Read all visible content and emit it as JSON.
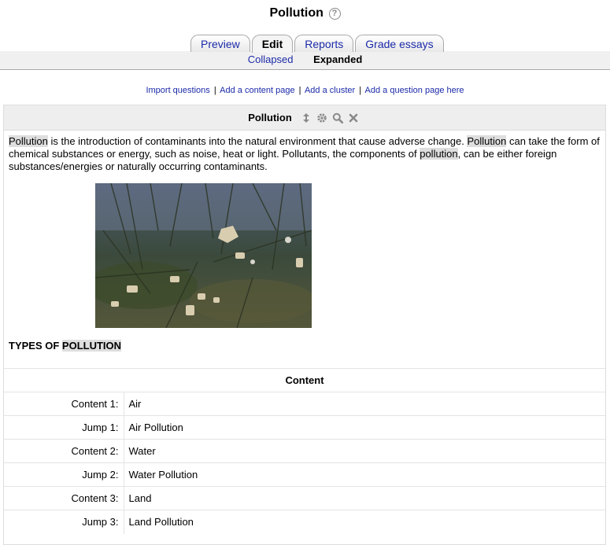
{
  "header": {
    "title": "Pollution",
    "help_glyph": "?"
  },
  "tabs": [
    {
      "label": "Preview",
      "active": false
    },
    {
      "label": "Edit",
      "active": true
    },
    {
      "label": "Reports",
      "active": false
    },
    {
      "label": "Grade essays",
      "active": false
    }
  ],
  "subtabs": [
    {
      "label": "Collapsed",
      "active": false
    },
    {
      "label": "Expanded",
      "active": true
    }
  ],
  "actions": [
    "Import questions",
    "Add a content page",
    "Add a cluster",
    "Add a question page here"
  ],
  "action_separator": "|",
  "page": {
    "title": "Pollution",
    "controls": [
      "move-icon",
      "settings-icon",
      "preview-icon",
      "delete-icon"
    ],
    "intro": {
      "w1": "Pollution",
      "t1": " is the introduction of contaminants into the natural environment that cause adverse change. ",
      "w2": "Pollution",
      "t2": " can take the form of chemical substances or energy, such as noise, heat or light. Pollutants, the components of ",
      "w3": "pollution",
      "t3": ", can be either foreign substances/energies or naturally occurring contaminants."
    },
    "types_prefix": "TYPES OF ",
    "types_highlight": "POLLUTION",
    "content_header": "Content",
    "rows": [
      {
        "label": "Content 1:",
        "value": "Air"
      },
      {
        "label": "Jump 1:",
        "value": "Air Pollution"
      },
      {
        "label": "Content 2:",
        "value": "Water"
      },
      {
        "label": "Jump 2:",
        "value": "Water Pollution"
      },
      {
        "label": "Content 3:",
        "value": "Land"
      },
      {
        "label": "Jump 3:",
        "value": "Land Pollution"
      }
    ]
  },
  "colors": {
    "link": "#1b2aa8",
    "highlight": "#dedede",
    "header_bg": "#eeeeee"
  }
}
